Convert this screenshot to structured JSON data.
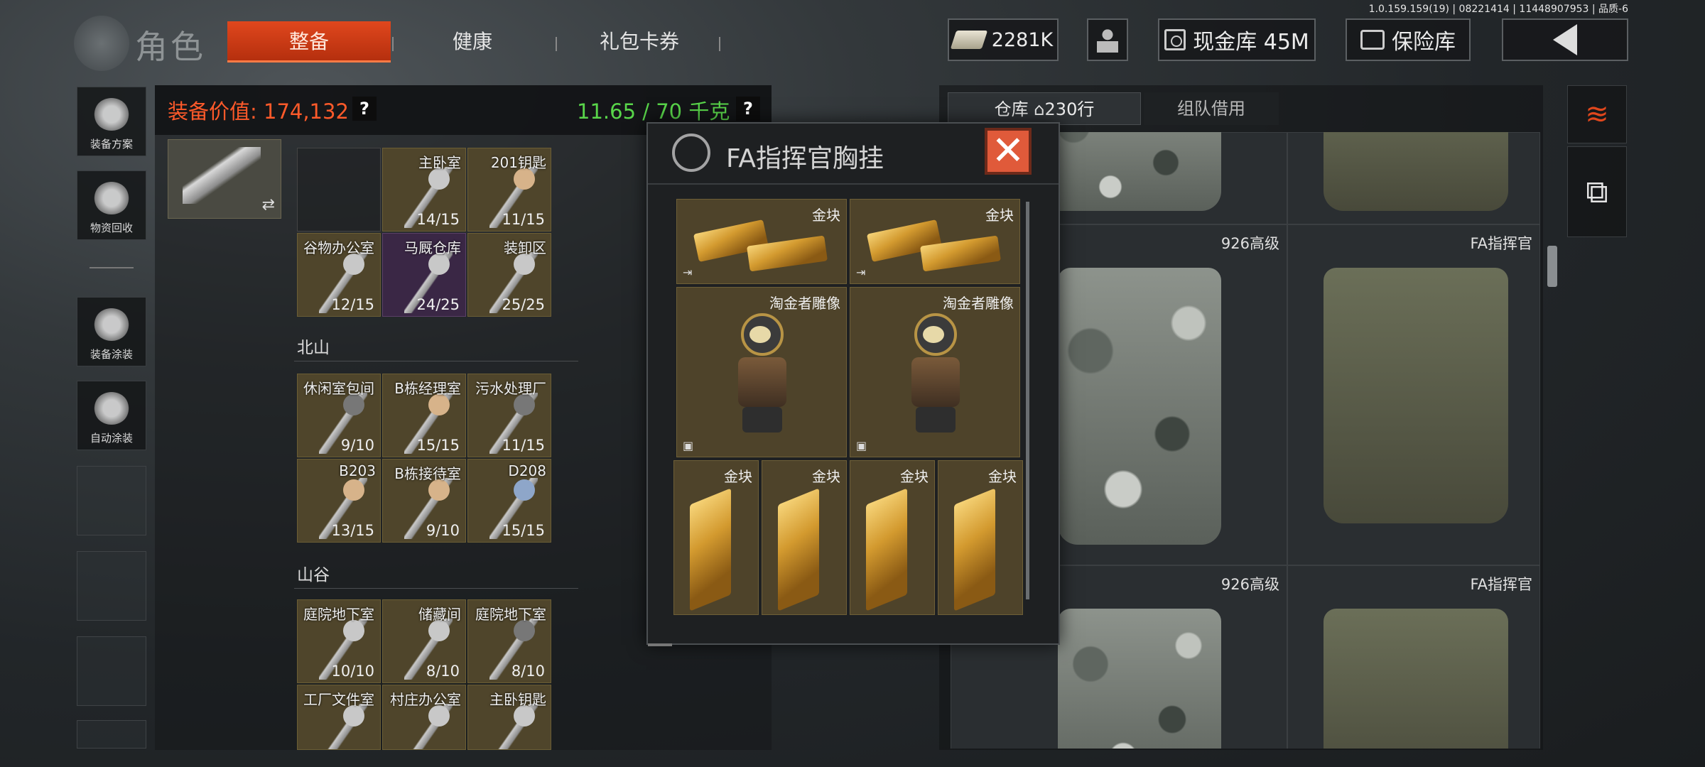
{
  "build_info": "1.0.159.159(19) | 08221414 | 11448907953 | 品质-6",
  "header": {
    "title": "角色",
    "tabs": [
      {
        "label": "整备",
        "active": true
      },
      {
        "label": "健康",
        "active": false
      },
      {
        "label": "礼包卡券",
        "active": false
      }
    ],
    "currency": "2281K",
    "cash_vault": "现金库 45M",
    "safe": "保险库"
  },
  "sidebar": {
    "items": [
      {
        "label": "装备方案",
        "icon": "helmet-grid-icon"
      },
      {
        "label": "物资回收",
        "icon": "recycle-face-icon"
      },
      {
        "label": "装备涂装",
        "icon": "helmet-paint-icon"
      },
      {
        "label": "自动涂装",
        "icon": "brush-gear-icon"
      }
    ]
  },
  "equipment": {
    "value_label": "装备价值: 174,132",
    "weight_label": "11.65 / 70 千克",
    "help": "?"
  },
  "keys": {
    "top_grid": [
      {
        "name": "",
        "count": ""
      },
      {
        "name": "主卧室",
        "count": "14/15"
      },
      {
        "name": "201钥匙",
        "count": "11/15"
      },
      {
        "name": "谷物办公室",
        "count": "12/15"
      },
      {
        "name": "马厩仓库",
        "count": "24/25"
      },
      {
        "name": "装卸区",
        "count": "25/25"
      }
    ],
    "sections": [
      {
        "title": "北山",
        "items": [
          {
            "name": "休闲室包间",
            "count": "9/10"
          },
          {
            "name": "B栋经理室",
            "count": "15/15"
          },
          {
            "name": "污水处理厂",
            "count": "11/15"
          },
          {
            "name": "B203",
            "count": "13/15"
          },
          {
            "name": "B栋接待室",
            "count": "9/10"
          },
          {
            "name": "D208",
            "count": "15/15"
          }
        ]
      },
      {
        "title": "山谷",
        "items": [
          {
            "name": "庭院地下室",
            "count": "10/10"
          },
          {
            "name": "储藏间",
            "count": "8/10"
          },
          {
            "name": "庭院地下室",
            "count": "8/10"
          },
          {
            "name": "工厂文件室",
            "count": ""
          },
          {
            "name": "村庄办公室",
            "count": ""
          },
          {
            "name": "主卧钥匙",
            "count": ""
          }
        ]
      }
    ]
  },
  "popup": {
    "title": "FA指挥官胸挂",
    "close": "✕",
    "items": [
      "金块",
      "金块",
      "淘金者雕像",
      "淘金者雕像",
      "金块",
      "金块",
      "金块",
      "金块"
    ]
  },
  "warehouse": {
    "tab_storage": "仓库",
    "rows": "230行",
    "tab_team": "组队借用",
    "cells": [
      "926高级",
      "FA指挥官",
      "926高级",
      "FA指挥官"
    ]
  },
  "colors": {
    "accent": "#e0471d",
    "value_red": "#ff5a2a",
    "weight_green": "#59d64a",
    "slot_gold": "#4f452b"
  }
}
